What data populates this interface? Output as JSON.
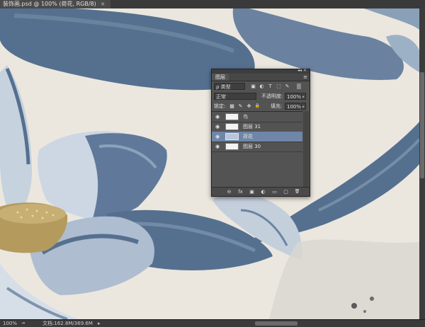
{
  "document_tab": {
    "title": "装饰画.psd @ 100% (荷花, RGB/8)",
    "close": "×"
  },
  "status_bar": {
    "zoom": "100%",
    "doc_info": "文档:162.8M/369.6M",
    "arrow": "▸"
  },
  "layers_panel": {
    "grip_controls": "◂◂ ×",
    "tab_label": "图层",
    "menu_icon": "≡",
    "filter": {
      "value": "ρ 类型",
      "icons": [
        "▣",
        "◐",
        "T",
        "⬚",
        "✎"
      ]
    },
    "blend_mode": {
      "value": "正常"
    },
    "opacity": {
      "label": "不透明度:",
      "value": "100%"
    },
    "lock": {
      "label": "锁定:",
      "icons": [
        "▩",
        "✎",
        "✥",
        "🔒"
      ]
    },
    "fill": {
      "label": "填充:",
      "value": "100%"
    },
    "layers": [
      {
        "name": "鸟",
        "visible": true,
        "selected": false
      },
      {
        "name": "图层 31",
        "visible": true,
        "selected": false
      },
      {
        "name": "荷花",
        "visible": true,
        "selected": true
      },
      {
        "name": "图层 30",
        "visible": true,
        "selected": false
      }
    ],
    "footer_icons": [
      "⊖",
      "fx",
      "▣",
      "◐",
      "▭",
      "▢",
      "🗑"
    ]
  },
  "colors": {
    "petal": "#55708f",
    "petal_light": "#c9d4e1",
    "canvas_bg": "#ebe7df",
    "seed_pod": "#b59a5e",
    "selection": "#6e86a8"
  }
}
